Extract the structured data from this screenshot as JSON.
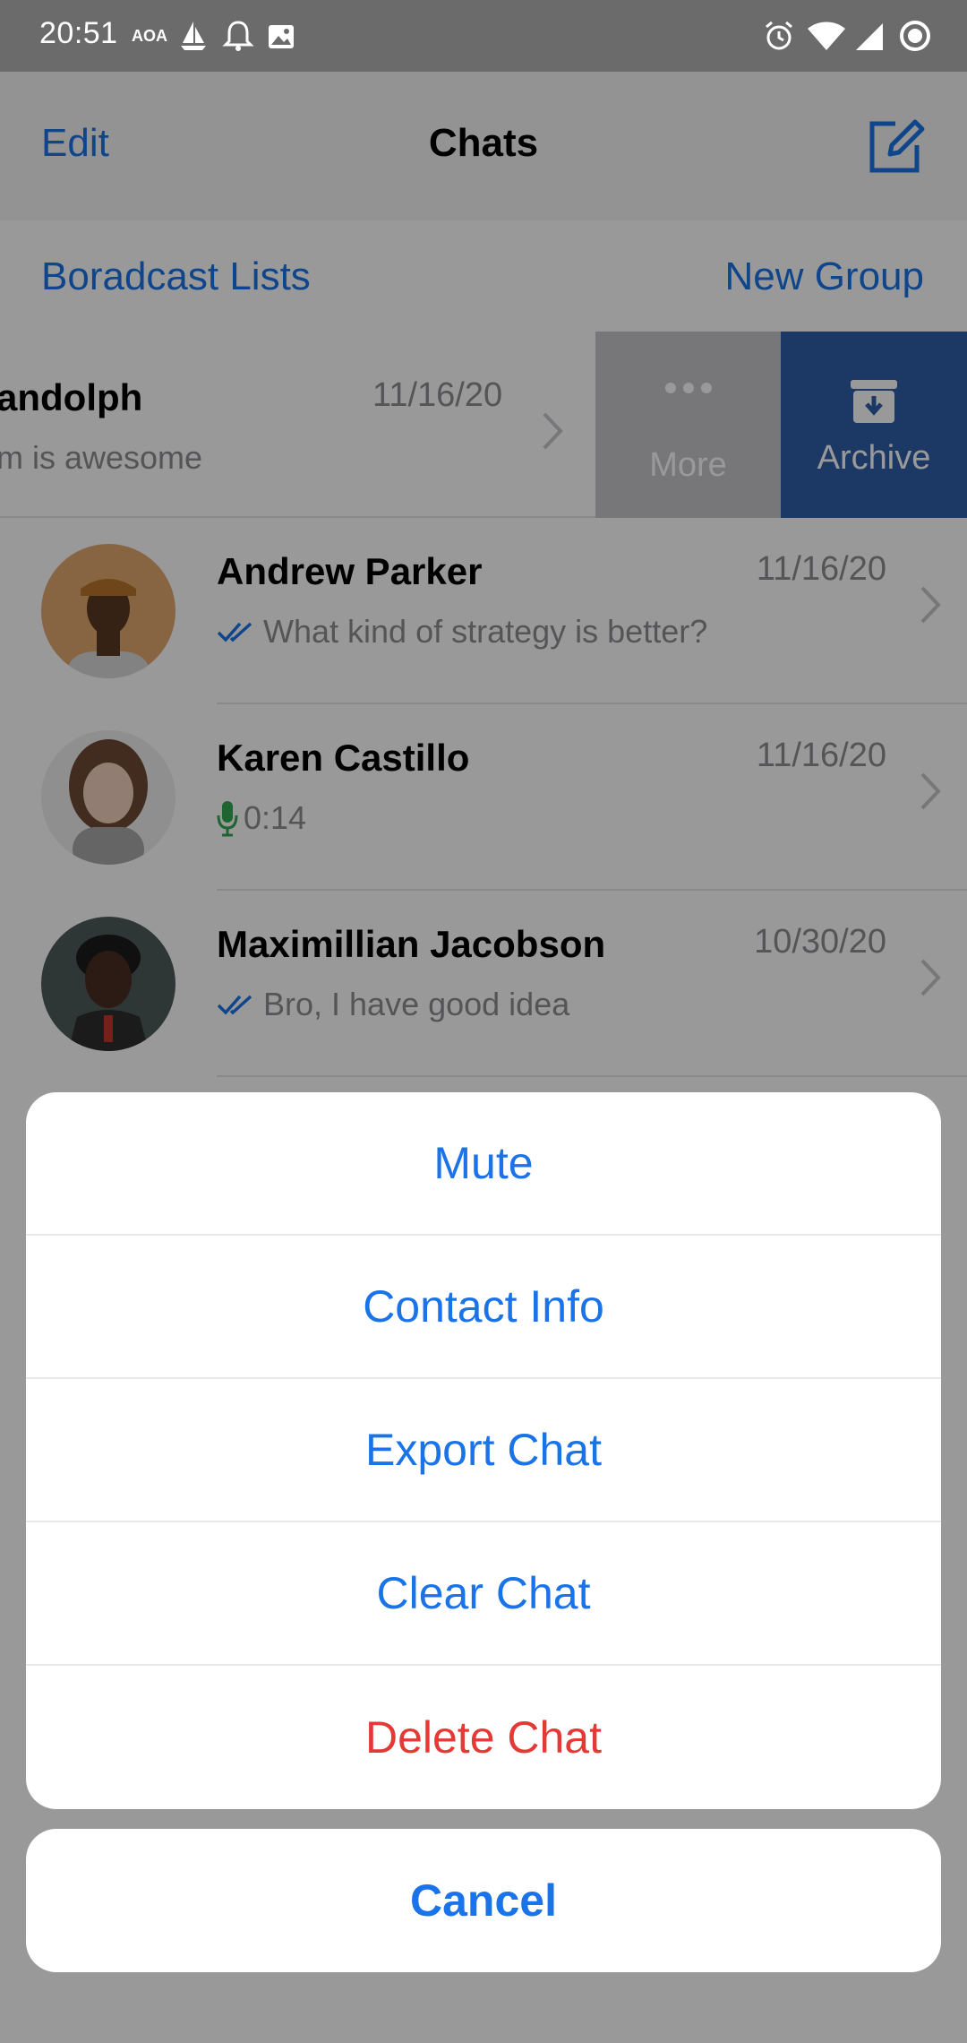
{
  "status_bar": {
    "time": "20:51",
    "carrier_tag": "AOA",
    "left_icons": [
      "sailboat-icon",
      "bell-icon",
      "image-icon"
    ],
    "right_icons": [
      "alarm-icon",
      "wifi-icon",
      "signal-icon",
      "circle-status-icon"
    ]
  },
  "nav": {
    "edit_label": "Edit",
    "title": "Chats",
    "compose_icon": "compose-icon"
  },
  "subnav": {
    "broadcast_label": "Boradcast Lists",
    "new_group_label": "New Group"
  },
  "swiped_chat": {
    "name": "andolph",
    "preview": "m is awesome",
    "date": "11/16/20",
    "more_label": "More",
    "archive_label": "Archive"
  },
  "chats": [
    {
      "name": "Andrew Parker",
      "date": "11/16/20",
      "preview": "What kind of strategy is better?",
      "status": "read-checkmarks-icon"
    },
    {
      "name": "Karen Castillo",
      "date": "11/16/20",
      "preview": "0:14",
      "status": "microphone-icon"
    },
    {
      "name": "Maximillian Jacobson",
      "date": "10/30/20",
      "preview": "Bro, I have good idea",
      "status": "read-checkmarks-icon"
    }
  ],
  "action_sheet": {
    "items": [
      {
        "label": "Mute"
      },
      {
        "label": "Contact Info"
      },
      {
        "label": "Export Chat"
      },
      {
        "label": "Clear Chat"
      },
      {
        "label": "Delete Chat"
      }
    ],
    "cancel_label": "Cancel"
  },
  "colors": {
    "accent": "#1a73e8",
    "destructive": "#e53935",
    "archive": "#2f5fa8",
    "more": "#c7c7cc",
    "voice": "#34a853"
  }
}
